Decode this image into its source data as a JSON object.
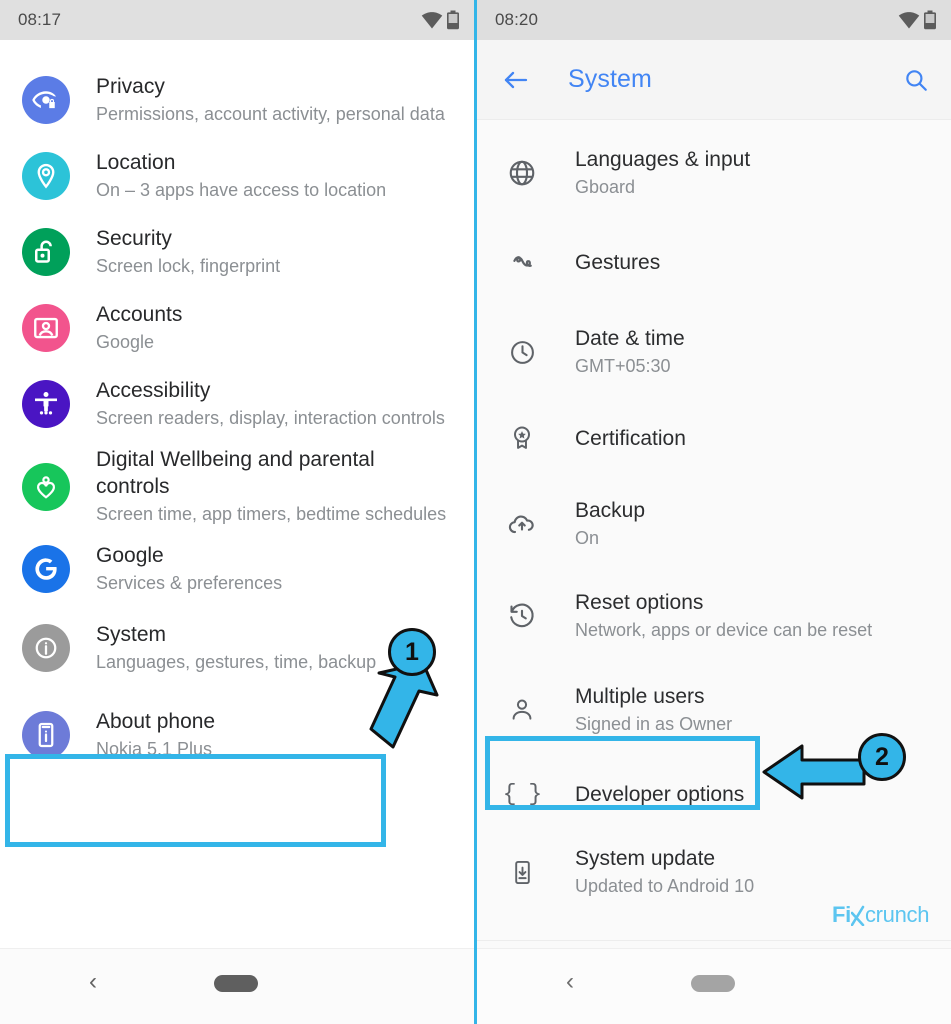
{
  "left_phone": {
    "status_bar": {
      "time": "08:17",
      "icons": [
        "wifi-icon",
        "battery-icon"
      ]
    },
    "settings_items": [
      {
        "title": "Privacy",
        "subtitle": "Permissions, account activity, personal data",
        "icon": "privacy-eye-lock-icon",
        "icon_color": "#5b7ce6"
      },
      {
        "title": "Location",
        "subtitle": "On – 3 apps have access to location",
        "icon": "location-pin-icon",
        "icon_color": "#2cc3d8"
      },
      {
        "title": "Security",
        "subtitle": "Screen lock, fingerprint",
        "icon": "security-unlocked-padlock-icon",
        "icon_color": "#00a05a"
      },
      {
        "title": "Accounts",
        "subtitle": "Google",
        "icon": "accounts-person-card-icon",
        "icon_color": "#f2548d"
      },
      {
        "title": "Accessibility",
        "subtitle": "Screen readers, display, interaction controls",
        "icon": "accessibility-body-icon",
        "icon_color": "#4a15c3"
      },
      {
        "title": "Digital Wellbeing and parental controls",
        "subtitle": "Screen time, app timers, bedtime schedules",
        "icon": "digital-wellbeing-heart-icon",
        "icon_color": "#17c65b"
      },
      {
        "title": "Google",
        "subtitle": "Services & preferences",
        "icon": "google-g-icon",
        "icon_color": "#1a73e8"
      },
      {
        "title": "System",
        "subtitle": "Languages, gestures, time, backup",
        "icon": "system-info-icon",
        "icon_color": "#9b9b9b"
      },
      {
        "title": "About phone",
        "subtitle": "Nokia 5.1 Plus",
        "icon": "about-phone-icon",
        "icon_color": "#6d7bd8"
      }
    ],
    "nav_bar": {
      "back": "nav-back-icon",
      "home": "nav-home-pill"
    }
  },
  "right_phone": {
    "status_bar": {
      "time": "08:20",
      "icons": [
        "wifi-icon",
        "battery-icon"
      ]
    },
    "app_bar": {
      "back_icon": "arrow-back-icon",
      "title": "System",
      "search_icon": "search-icon",
      "title_color": "#4285f4"
    },
    "settings_items": [
      {
        "title": "Languages & input",
        "subtitle": "Gboard",
        "icon": "globe-icon"
      },
      {
        "title": "Gestures",
        "subtitle": "",
        "icon": "gesture-swirl-icon"
      },
      {
        "title": "Date & time",
        "subtitle": "GMT+05:30",
        "icon": "clock-icon"
      },
      {
        "title": "Certification",
        "subtitle": "",
        "icon": "certification-award-icon"
      },
      {
        "title": "Backup",
        "subtitle": "On",
        "icon": "cloud-upload-icon"
      },
      {
        "title": "Reset options",
        "subtitle": "Network, apps or device can be reset",
        "icon": "restore-history-icon"
      },
      {
        "title": "Multiple users",
        "subtitle": "Signed in as Owner",
        "icon": "person-icon"
      },
      {
        "title": "Developer options",
        "subtitle": "",
        "icon": "curly-braces-icon"
      },
      {
        "title": "System update",
        "subtitle": "Updated to Android 10",
        "icon": "system-update-phone-icon"
      }
    ],
    "nav_bar": {
      "back": "nav-back-icon",
      "home": "nav-home-pill"
    }
  },
  "annotations": {
    "highlight_color": "#33b5e8",
    "callouts": [
      {
        "number": "1",
        "target": "System",
        "arrow": "arrow-down-left"
      },
      {
        "number": "2",
        "target": "Developer options",
        "arrow": "arrow-left"
      }
    ]
  },
  "watermark": {
    "bold_part": "Fi",
    "rest_part": "crunch"
  }
}
